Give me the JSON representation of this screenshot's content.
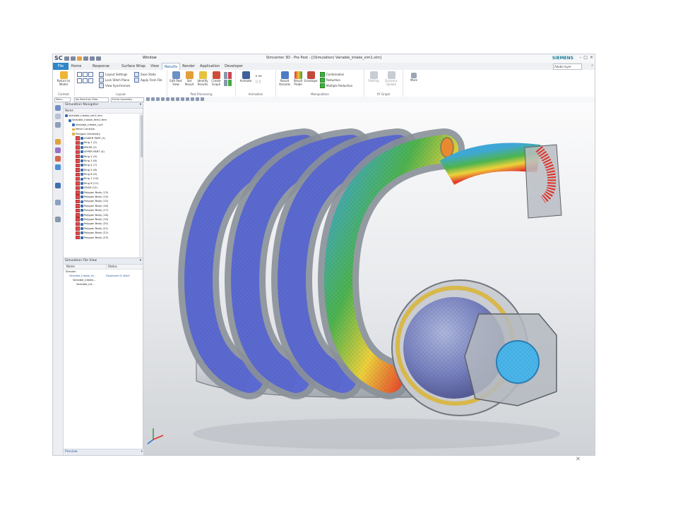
{
  "titlebar": {
    "logo": "SC",
    "title": "Simcenter 3D - Pre Post - [(Simulation) Variable_intake_sim1.sim]",
    "brand": "SIEMENS",
    "window_menu": "Window"
  },
  "tabs": [
    "File",
    "Home",
    "Response Dynamics",
    "Surface Wrap",
    "View",
    "Results",
    "Render",
    "Application",
    "Developer"
  ],
  "active_tab": "Results",
  "search": {
    "value": "Adobe layer"
  },
  "ribbon": {
    "context": {
      "return_label": "Return to Model",
      "group": "Context"
    },
    "layout": {
      "items": [
        "Layout Settings",
        "Lock Stitch Plane",
        "View Synchronize",
        "Save State",
        "Apply From File"
      ],
      "group": "Layout"
    },
    "post": {
      "buttons": [
        "Edit Post View",
        "Set Result",
        "Identify Results",
        "Create Graph"
      ],
      "group": "Post Processing"
    },
    "animation": {
      "button": "Animate",
      "group": "Animation"
    },
    "manipulation": {
      "buttons": [
        "Result Variants",
        "Result Probe",
        "Envelope"
      ],
      "items": [
        "Combination",
        "Reduction",
        "Multiple Reduction"
      ],
      "group": "Manipulation"
    },
    "xygraph": {
      "buttons": [
        "Plotting",
        "Dynamic Update"
      ],
      "group": "XY Graph"
    },
    "more": "More"
  },
  "toolbar2": {
    "menu": "Menu",
    "filter": "No Selection Filter",
    "assembly": "Entire Assembly"
  },
  "navigator": {
    "title": "Simulation Navigator",
    "column": "Name",
    "nodes": [
      {
        "label": "Variable_intake_sim1.sim",
        "indent": 0,
        "kind": "file"
      },
      {
        "label": "Variable_intake_fem1.fem",
        "indent": 1,
        "kind": "node"
      },
      {
        "label": "Variable_intake_i.prt",
        "indent": 2,
        "kind": "node"
      },
      {
        "label": "Mesh Controls",
        "indent": 2,
        "kind": "folder"
      },
      {
        "label": "Polygon Geometry",
        "indent": 2,
        "kind": "folder"
      },
      {
        "label": "LOWER PART (1)",
        "indent": 3,
        "kind": "body"
      },
      {
        "label": "Ring 1 (2)",
        "indent": 3,
        "kind": "body"
      },
      {
        "label": "DRUM (3)",
        "indent": 3,
        "kind": "body"
      },
      {
        "label": "UPPER PART (4)",
        "indent": 3,
        "kind": "body"
      },
      {
        "label": "Ring 2 (5)",
        "indent": 3,
        "kind": "body"
      },
      {
        "label": "Ring 3 (6)",
        "indent": 3,
        "kind": "body"
      },
      {
        "label": "Ring 4 (7)",
        "indent": 3,
        "kind": "body"
      },
      {
        "label": "Ring 5 (8)",
        "indent": 3,
        "kind": "body"
      },
      {
        "label": "Ring 6 (9)",
        "indent": 3,
        "kind": "body"
      },
      {
        "label": "Ring 7 (10)",
        "indent": 3,
        "kind": "body"
      },
      {
        "label": "Ring 8 (11)",
        "indent": 3,
        "kind": "body"
      },
      {
        "label": "GEAR (12)",
        "indent": 3,
        "kind": "body"
      },
      {
        "label": "Polygon Body (13)",
        "indent": 3,
        "kind": "body"
      },
      {
        "label": "Polygon Body (14)",
        "indent": 3,
        "kind": "body"
      },
      {
        "label": "Polygon Body (15)",
        "indent": 3,
        "kind": "body"
      },
      {
        "label": "Polygon Body (16)",
        "indent": 3,
        "kind": "body"
      },
      {
        "label": "Polygon Body (17)",
        "indent": 3,
        "kind": "body"
      },
      {
        "label": "Polygon Body (18)",
        "indent": 3,
        "kind": "body"
      },
      {
        "label": "Polygon Body (19)",
        "indent": 3,
        "kind": "body"
      },
      {
        "label": "Polygon Body (20)",
        "indent": 3,
        "kind": "body"
      },
      {
        "label": "Polygon Body (21)",
        "indent": 3,
        "kind": "body"
      },
      {
        "label": "Polygon Body (22)",
        "indent": 3,
        "kind": "body"
      },
      {
        "label": "Polygon Body (23)",
        "indent": 3,
        "kind": "body"
      }
    ]
  },
  "file_view": {
    "title": "Simulation File View",
    "columns": [
      "Name",
      "Status"
    ],
    "rows": [
      {
        "name": "Session",
        "status": "",
        "indent": 0
      },
      {
        "name": "Variable_intake_sf...",
        "status": "Displayed & Work",
        "indent": 1
      },
      {
        "name": "Variable_intake...",
        "status": "",
        "indent": 2
      },
      {
        "name": "Variable_int...",
        "status": "",
        "indent": 3
      }
    ],
    "preview": "Preview"
  },
  "colors": {
    "accent": "#2f86c8",
    "brand": "#1b7c96",
    "mesh_blue": "#5b6ad0",
    "hot_red": "#e0322a",
    "mid_green": "#4db44d",
    "yellow": "#efd23a"
  },
  "icons": {
    "resource_bar": [
      "home-icon",
      "part-icon",
      "nav-icon",
      "constraint-icon",
      "history-icon",
      "reuse-icon",
      "web-icon",
      "role-icon",
      "clock-icon",
      "settings-icon"
    ]
  }
}
